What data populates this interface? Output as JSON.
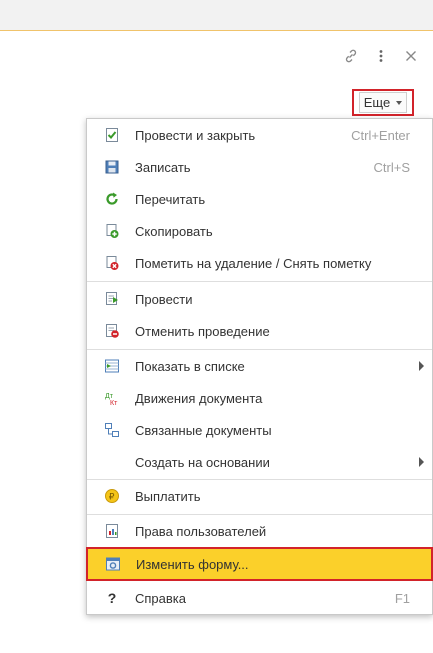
{
  "window": {
    "link_icon": "link-icon",
    "more_icon": "vertical-dots-icon",
    "close_icon": "close-icon"
  },
  "more_button": {
    "label": "Еще"
  },
  "menu": {
    "items": [
      {
        "label": "Провести и закрыть",
        "shortcut": "Ctrl+Enter",
        "icon": "post-and-close-icon"
      },
      {
        "label": "Записать",
        "shortcut": "Ctrl+S",
        "icon": "save-icon"
      },
      {
        "label": "Перечитать",
        "shortcut": "",
        "icon": "refresh-icon"
      },
      {
        "label": "Скопировать",
        "shortcut": "",
        "icon": "copy-icon"
      },
      {
        "label": "Пометить на удаление / Снять пометку",
        "shortcut": "",
        "icon": "mark-delete-icon"
      },
      {
        "label": "Провести",
        "shortcut": "",
        "icon": "post-icon"
      },
      {
        "label": "Отменить проведение",
        "shortcut": "",
        "icon": "unpost-icon"
      },
      {
        "label": "Показать в списке",
        "shortcut": "",
        "icon": "show-in-list-icon"
      },
      {
        "label": "Движения документа",
        "shortcut": "",
        "icon": "document-movements-icon"
      },
      {
        "label": "Связанные документы",
        "shortcut": "",
        "icon": "related-documents-icon"
      },
      {
        "label": "Создать на основании",
        "shortcut": "",
        "icon": ""
      },
      {
        "label": "Выплатить",
        "shortcut": "",
        "icon": "ruble-coin-icon"
      },
      {
        "label": "Права пользователей",
        "shortcut": "",
        "icon": "user-rights-icon"
      },
      {
        "label": "Изменить форму...",
        "shortcut": "",
        "icon": "change-form-icon"
      },
      {
        "label": "Справка",
        "shortcut": "F1",
        "icon": "help-icon"
      }
    ],
    "icon_text": {
      "dt": "Дт",
      "kt": "Кт",
      "help": "?",
      "ruble": "₽"
    }
  },
  "colors": {
    "highlight_fill": "#fbd02a",
    "highlight_border": "#d2232a",
    "accent_green": "#3a9a2a",
    "accent_red": "#d2232a"
  }
}
